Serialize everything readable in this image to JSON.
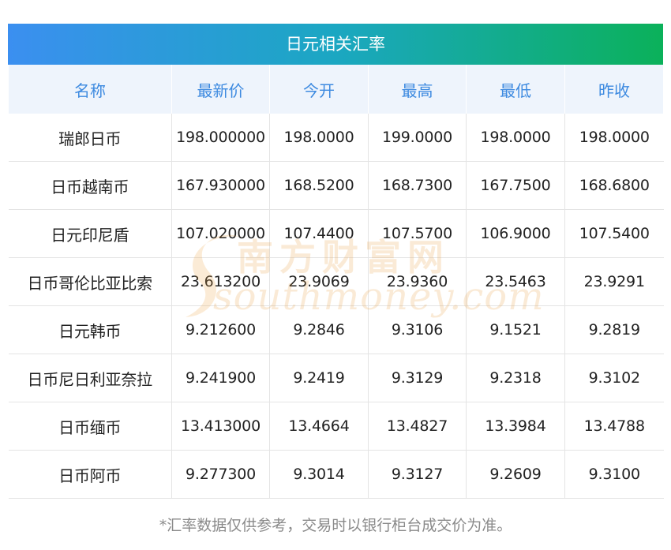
{
  "title": "日元相关汇率",
  "headers": [
    "名称",
    "最新价",
    "今开",
    "最高",
    "最低",
    "昨收"
  ],
  "rows": [
    [
      "瑞郎日币",
      "198.000000",
      "198.0000",
      "199.0000",
      "198.0000",
      "198.0000"
    ],
    [
      "日币越南币",
      "167.930000",
      "168.5200",
      "168.7300",
      "167.7500",
      "168.6800"
    ],
    [
      "日元印尼盾",
      "107.020000",
      "107.4400",
      "107.5700",
      "106.9000",
      "107.5400"
    ],
    [
      "日币哥伦比亚比索",
      "23.613200",
      "23.9069",
      "23.9360",
      "23.5463",
      "23.9291"
    ],
    [
      "日元韩币",
      "9.212600",
      "9.2846",
      "9.3106",
      "9.1521",
      "9.2819"
    ],
    [
      "日币尼日利亚奈拉",
      "9.241900",
      "9.2419",
      "9.3129",
      "9.2318",
      "9.3102"
    ],
    [
      "日币缅币",
      "13.413000",
      "13.4664",
      "13.4827",
      "13.3984",
      "13.4788"
    ],
    [
      "日币阿币",
      "9.277300",
      "9.3014",
      "9.3127",
      "9.2609",
      "9.3100"
    ]
  ],
  "footnote": "*汇率数据仅供参考，交易时以银行柜台成交价为准。",
  "watermark": {
    "cn": "南方财富网",
    "en": "southmoney.com"
  },
  "colors": {
    "header_text": "#3d8ae0",
    "gradient_start": "#3b8ff0",
    "gradient_end": "#0bb15a"
  }
}
